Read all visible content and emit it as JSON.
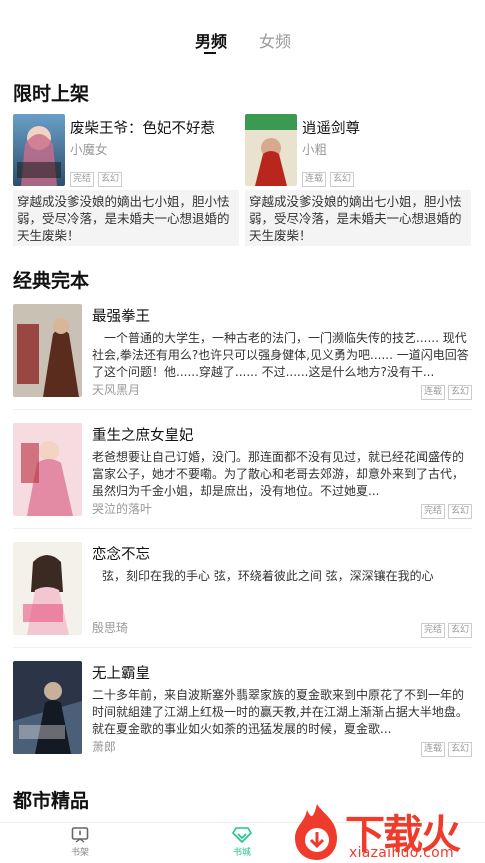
{
  "tabs": {
    "male": "男频",
    "female": "女频"
  },
  "sections": {
    "limited": "限时上架",
    "classic": "经典完本",
    "city": "都市精品"
  },
  "limited_books": [
    {
      "title": "废柴王爷：色妃不好惹",
      "author": "小魔女",
      "tags": [
        "完结",
        "玄幻"
      ],
      "desc": "穿越成没爹没娘的嫡出七小姐，胆小怯弱，受尽冷落，是未婚夫一心想退婚的天生废柴！"
    },
    {
      "title": "逍遥剑尊",
      "author": "小粗",
      "tags": [
        "连载",
        "玄幻"
      ],
      "desc": "穿越成没爹没娘的嫡出七小姐，胆小怯弱，受尽冷落，是未婚夫一心想退婚的天生废柴！"
    }
  ],
  "classic_books": [
    {
      "title": "最强拳王",
      "author": "天风黑月",
      "tags": [
        "连载",
        "玄幻"
      ],
      "desc": "　一个普通的大学生，一种古老的法门，一门濒临失传的技艺...... 现代社会,拳法还有用么?也许只可以强身健体,见义勇为吧...... 一道闪电回答了这个问题！他......穿越了...... 不过......这是什么地方?没有干..."
    },
    {
      "title": "重生之庶女皇妃",
      "author": "哭泣的落叶",
      "tags": [
        "完结",
        "玄幻"
      ],
      "desc": "老爸想要让自己订婚，没门。那连面都不没有见过，就已经花闻盛传的富家公子，她才不要嘞。为了散心和老哥去郊游，却意外来到了古代，虽然归为千金小姐，却是庶出，没有地位。不过她夏..."
    },
    {
      "title": "恋念不忘",
      "author": "殷思琦",
      "tags": [
        "完结",
        "玄幻"
      ],
      "desc": "弦，刻印在我的手心 弦，环绕着彼此之间 弦，深深镶在我的心"
    },
    {
      "title": "无上霸皇",
      "author": "萧郎",
      "tags": [
        "连载",
        "玄幻"
      ],
      "desc": "二十多年前，来自波斯塞外翡翠家族的夏金歌来到中原花了不到一年的时间就組建了江湖上红极一时的赢天教,并在江湖上渐渐占据大半地盘。就在夏金歌的事业如火如荼的迅猛发展的时候，夏金歌..."
    }
  ],
  "nav": {
    "shelf": "书架",
    "city": "书城"
  },
  "watermark": {
    "brand": "下载火",
    "url": "xiazaihuo.com"
  },
  "colors": {
    "accent": "#1ec88a",
    "watermark": "#ef3b2c"
  }
}
